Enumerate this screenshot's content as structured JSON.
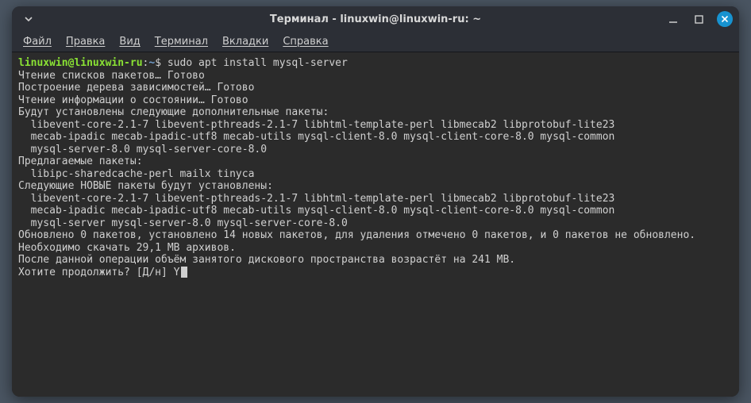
{
  "window": {
    "title": "Терминал - linuxwin@linuxwin-ru: ~"
  },
  "menubar": {
    "file": "Файл",
    "edit": "Правка",
    "view": "Вид",
    "terminal": "Терминал",
    "tabs": "Вкладки",
    "help": "Справка"
  },
  "prompt": {
    "user_host": "linuxwin@linuxwin-ru",
    "colon": ":",
    "path": "~",
    "symbol": "$ ",
    "command": "sudo apt install mysql-server"
  },
  "output": {
    "l1": "Чтение списков пакетов… Готово",
    "l2": "Построение дерева зависимостей… Готово",
    "l3": "Чтение информации о состоянии… Готово",
    "l4": "Будут установлены следующие дополнительные пакеты:",
    "l5": "libevent-core-2.1-7 libevent-pthreads-2.1-7 libhtml-template-perl libmecab2 libprotobuf-lite23",
    "l6": "mecab-ipadic mecab-ipadic-utf8 mecab-utils mysql-client-8.0 mysql-client-core-8.0 mysql-common",
    "l7": "mysql-server-8.0 mysql-server-core-8.0",
    "l8": "Предлагаемые пакеты:",
    "l9": "libipc-sharedcache-perl mailx tinyca",
    "l10": "Следующие НОВЫЕ пакеты будут установлены:",
    "l11": "libevent-core-2.1-7 libevent-pthreads-2.1-7 libhtml-template-perl libmecab2 libprotobuf-lite23",
    "l12": "mecab-ipadic mecab-ipadic-utf8 mecab-utils mysql-client-8.0 mysql-client-core-8.0 mysql-common",
    "l13": "mysql-server mysql-server-8.0 mysql-server-core-8.0",
    "l14": "Обновлено 0 пакетов, установлено 14 новых пакетов, для удаления отмечено 0 пакетов, и 0 пакетов не обновлено.",
    "l15": "Необходимо скачать 29,1 MB архивов.",
    "l16": "После данной операции объём занятого дискового пространства возрастёт на 241 MB.",
    "l17": "Хотите продолжить? [Д/н] ",
    "input": "Y"
  }
}
